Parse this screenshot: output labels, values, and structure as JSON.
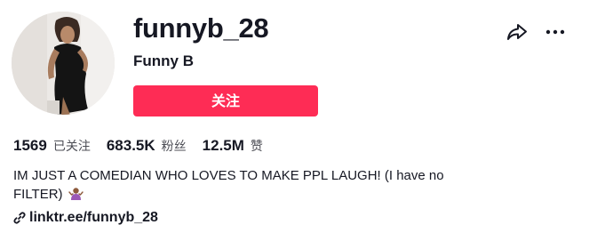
{
  "profile": {
    "username": "funnyb_28",
    "nickname": "Funny B",
    "follow_label": "关注",
    "accent_color": "#fe2c55",
    "avatar_alt": "profile-photo"
  },
  "header_actions": {
    "share_icon": "share-arrow-icon",
    "more_icon": "more-horizontal-icon"
  },
  "stats": [
    {
      "value": "1569",
      "label": "已关注"
    },
    {
      "value": "683.5K",
      "label": "粉丝"
    },
    {
      "value": "12.5M",
      "label": "赞"
    }
  ],
  "bio": {
    "text": "IM JUST A COMEDIAN WHO LOVES TO MAKE PPL LAUGH! (I have no FILTER)",
    "emoji_icon": "person-shrugging-emoji"
  },
  "link": {
    "text": "linktr.ee/funnyb_28",
    "icon": "link-icon"
  }
}
